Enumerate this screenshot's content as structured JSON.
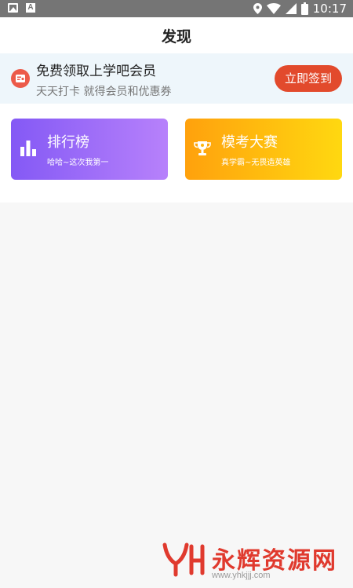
{
  "status_bar": {
    "time": "10:17",
    "icons": [
      "image-icon",
      "text-a-icon",
      "location-icon",
      "wifi-icon",
      "signal-icon",
      "battery-icon"
    ]
  },
  "header": {
    "title": "发现"
  },
  "banner": {
    "title": "免费领取上学吧会员",
    "subtitle": "天天打卡 就得会员和优惠券",
    "button_label": "立即签到",
    "button_color": "#e24a2c"
  },
  "cards": [
    {
      "title": "排行榜",
      "subtitle": "哈哈~这次我第一",
      "icon": "bar-chart-icon",
      "colors": [
        "#8459f5",
        "#b781fb"
      ]
    },
    {
      "title": "模考大赛",
      "subtitle": "真学霸~无畏造英雄",
      "icon": "trophy-icon",
      "colors": [
        "#ffa10d",
        "#ffd810"
      ]
    }
  ],
  "watermark": {
    "text": "永辉资源网",
    "url": "www.yhkjjj.com"
  }
}
